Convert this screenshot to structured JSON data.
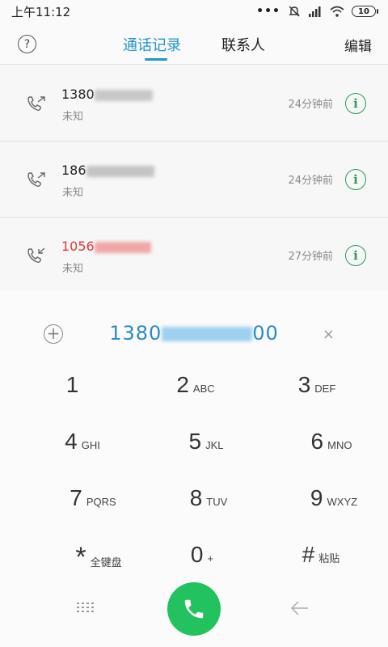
{
  "status_bar": {
    "time": "上午11:12",
    "dots": "•••",
    "battery": "10"
  },
  "header": {
    "help": "?",
    "tab_history": "通话记录",
    "tab_contacts": "联系人",
    "edit": "编辑"
  },
  "calls": [
    {
      "number_prefix": "1380",
      "label": "未知",
      "time": "24分钟前",
      "missed": false
    },
    {
      "number_prefix": "186",
      "label": "未知",
      "time": "24分钟前",
      "missed": false
    },
    {
      "number_prefix": "1056",
      "label": "未知",
      "time": "27分钟前",
      "missed": true
    }
  ],
  "dialer": {
    "add_icon": "+",
    "number_prefix": "1380",
    "number_suffix": "00",
    "clear": "×",
    "keys": [
      {
        "digit": "1",
        "sub": ""
      },
      {
        "digit": "2",
        "sub": "ABC"
      },
      {
        "digit": "3",
        "sub": "DEF"
      },
      {
        "digit": "4",
        "sub": "GHI"
      },
      {
        "digit": "5",
        "sub": "JKL"
      },
      {
        "digit": "6",
        "sub": "MNO"
      },
      {
        "digit": "7",
        "sub": "PQRS"
      },
      {
        "digit": "8",
        "sub": "TUV"
      },
      {
        "digit": "9",
        "sub": "WXYZ"
      },
      {
        "digit": "*",
        "sub": "全键盘"
      },
      {
        "digit": "0",
        "sub": "+"
      },
      {
        "digit": "#",
        "sub": "粘贴"
      }
    ]
  },
  "colors": {
    "accent": "#2196c8",
    "call_green": "#22c35e",
    "info_green": "#2e9a5a",
    "missed_red": "#e23a3a"
  }
}
